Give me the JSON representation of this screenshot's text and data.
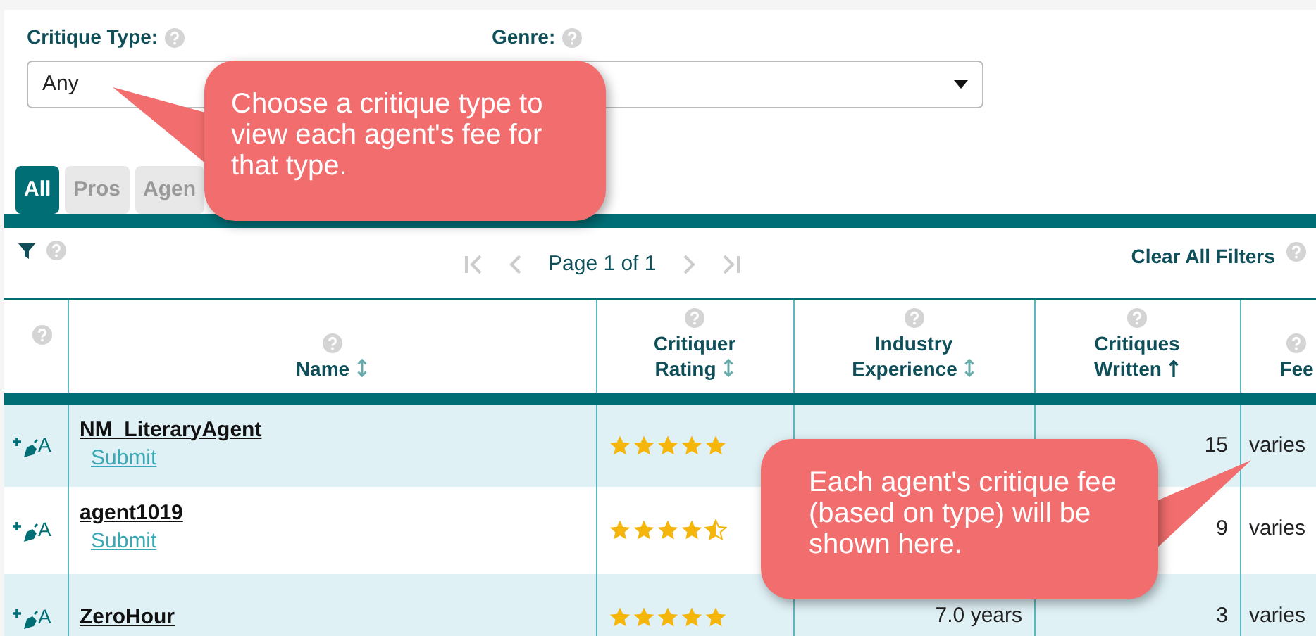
{
  "filters": [
    {
      "label": "Critique Type:",
      "value": "Any"
    },
    {
      "label": "Genre:"
    }
  ],
  "tabs": [
    {
      "label": "All",
      "selected": true
    },
    {
      "label": "Pros",
      "selected": false
    },
    {
      "label": "Agen",
      "selected": false
    }
  ],
  "pager": {
    "text": "Page 1 of 1",
    "clear": "Clear All Filters"
  },
  "table": {
    "columns": [
      {},
      {
        "label": "Name",
        "sortable": true,
        "sorted": false
      },
      {
        "label": "Critiquer Rating",
        "sortable": true,
        "sorted": false
      },
      {
        "label": "Industry Experience",
        "sortable": true,
        "sorted": false
      },
      {
        "label": "Critiques Written",
        "sortable": true,
        "sorted": true
      },
      {
        "label": "Fee"
      }
    ],
    "rows": [
      {
        "badge": "A",
        "name": "NM_LiteraryAgent",
        "link": "Submit",
        "stars": 5,
        "written": "15",
        "fee": "varies"
      },
      {
        "badge": "A",
        "name": "agent1019",
        "link": "Submit",
        "stars": 4.5,
        "written": "9",
        "fee": "varies"
      },
      {
        "badge": "A",
        "name": "ZeroHour",
        "stars": 5,
        "experience": "7.0 years",
        "written": "3",
        "fee": "varies"
      }
    ]
  },
  "callouts": [
    {
      "text": "Choose a critique type to view each agent's fee for that type."
    },
    {
      "text": "Each agent's critique fee (based on type) will be shown here."
    }
  ]
}
